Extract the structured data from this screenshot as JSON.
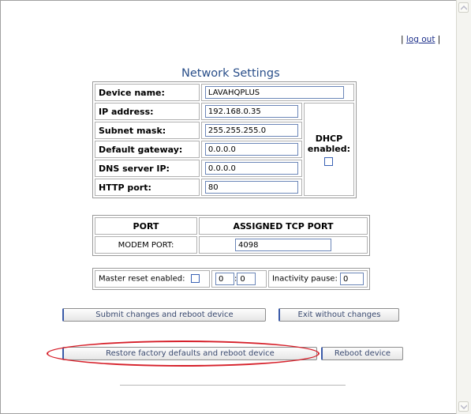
{
  "header": {
    "logout_prefix": "|",
    "logout_label": "log out",
    "logout_suffix": "|"
  },
  "page_title": "Network Settings",
  "network": {
    "device_name": {
      "label": "Device name:",
      "value": "LAVAHQPLUS"
    },
    "ip_address": {
      "label": "IP address:",
      "value": "192.168.0.35"
    },
    "subnet_mask": {
      "label": "Subnet mask:",
      "value": "255.255.255.0"
    },
    "default_gateway": {
      "label": "Default gateway:",
      "value": "0.0.0.0"
    },
    "dns_server_ip": {
      "label": "DNS server IP:",
      "value": "0.0.0.0"
    },
    "http_port": {
      "label": "HTTP port:",
      "value": "80"
    },
    "dhcp": {
      "label_line1": "DHCP",
      "label_line2": "enabled:",
      "checked": false
    }
  },
  "ports": {
    "headers": [
      "PORT",
      "ASSIGNED TCP PORT"
    ],
    "rows": [
      {
        "port": "MODEM PORT:",
        "tcp": "4098"
      }
    ]
  },
  "misc": {
    "master_reset_label": "Master reset enabled:",
    "master_reset_checked": false,
    "reset_value_1": "0",
    "separator": ":",
    "reset_value_2": "0",
    "inactivity_label": "Inactivity pause:",
    "inactivity_value": "0"
  },
  "buttons": {
    "submit": "Submit changes and reboot device",
    "exit": "Exit without changes",
    "restore": "Restore factory defaults and reboot device",
    "reboot": "Reboot device"
  },
  "colors": {
    "title": "#2a4f8a",
    "highlight_ellipse": "#d6202a",
    "checkbox_border": "#3a62b4"
  }
}
